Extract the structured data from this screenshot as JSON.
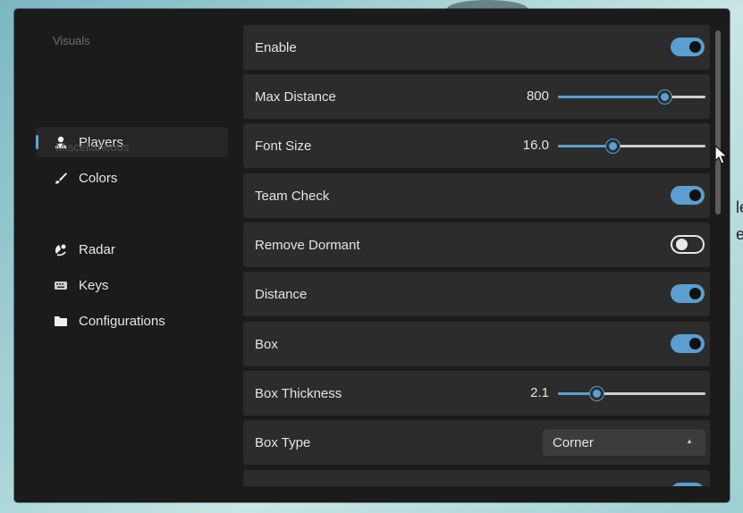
{
  "background": {
    "side_text_1": "le",
    "side_text_2": "e"
  },
  "sidebar": {
    "section_visuals": "Visuals",
    "section_misc": "Miscellaneous",
    "items": [
      {
        "label": "Players",
        "icon": "user-icon",
        "active": true
      },
      {
        "label": "Colors",
        "icon": "brush-icon"
      },
      {
        "label": "Radar",
        "icon": "radar-icon"
      },
      {
        "label": "Keys",
        "icon": "keyboard-icon"
      },
      {
        "label": "Configurations",
        "icon": "folder-icon"
      }
    ]
  },
  "settings": {
    "enable": {
      "label": "Enable",
      "on": true
    },
    "max_distance": {
      "label": "Max Distance",
      "value": "800",
      "fraction": 0.72
    },
    "font_size": {
      "label": "Font Size",
      "value": "16.0",
      "fraction": 0.37
    },
    "team_check": {
      "label": "Team Check",
      "on": true
    },
    "remove_dormant": {
      "label": "Remove Dormant",
      "on": false
    },
    "distance": {
      "label": "Distance",
      "on": true
    },
    "box": {
      "label": "Box",
      "on": true
    },
    "box_thickness": {
      "label": "Box Thickness",
      "value": "2.1",
      "fraction": 0.26
    },
    "box_type": {
      "label": "Box Type",
      "selected": "Corner"
    }
  },
  "colors": {
    "accent": "#5a9fcf",
    "row_bg": "#2c2c2c",
    "window_bg": "#1b1b1b"
  }
}
